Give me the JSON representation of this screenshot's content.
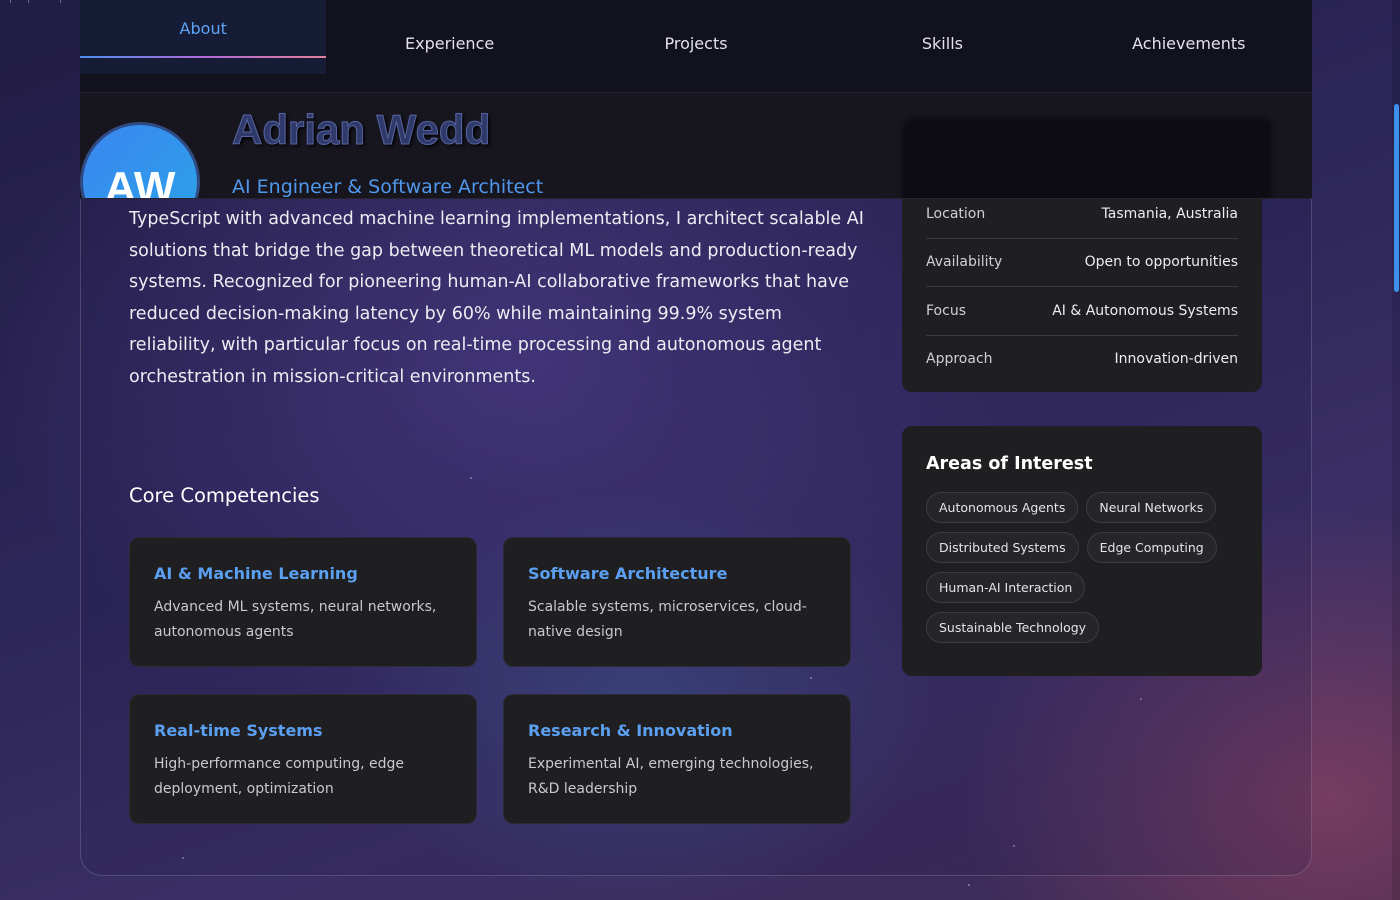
{
  "nav": {
    "tabs": [
      {
        "label": "About",
        "active": true
      },
      {
        "label": "Experience",
        "active": false
      },
      {
        "label": "Projects",
        "active": false
      },
      {
        "label": "Skills",
        "active": false
      },
      {
        "label": "Achievements",
        "active": false
      }
    ]
  },
  "profile": {
    "initials": "AW",
    "name": "Adrian Wedd",
    "role": "AI Engineer & Software Architect"
  },
  "bio": "TypeScript with advanced machine learning implementations, I architect scalable AI solutions that bridge the gap between theoretical ML models and production-ready systems. Recognized for pioneering human-AI collaborative frameworks that have reduced decision-making latency by 60% while maintaining 99.9% system reliability, with particular focus on real-time processing and autonomous agent orchestration in mission-critical environments.",
  "competencies": {
    "heading": "Core Competencies",
    "items": [
      {
        "title": "AI & Machine Learning",
        "desc": "Advanced ML systems, neural networks, autonomous agents"
      },
      {
        "title": "Software Architecture",
        "desc": "Scalable systems, microservices, cloud-native design"
      },
      {
        "title": "Real-time Systems",
        "desc": "High-performance computing, edge deployment, optimization"
      },
      {
        "title": "Research & Innovation",
        "desc": "Experimental AI, emerging technologies, R&D leadership"
      }
    ]
  },
  "info": {
    "rows": [
      {
        "key": "Location",
        "value": "Tasmania, Australia"
      },
      {
        "key": "Availability",
        "value": "Open to opportunities"
      },
      {
        "key": "Focus",
        "value": "AI & Autonomous Systems"
      },
      {
        "key": "Approach",
        "value": "Innovation-driven"
      }
    ]
  },
  "interests": {
    "heading": "Areas of Interest",
    "chips": [
      "Autonomous Agents",
      "Neural Networks",
      "Distributed Systems",
      "Edge Computing",
      "Human-AI Interaction",
      "Sustainable Technology"
    ]
  },
  "colors": {
    "accent": "#5b9ff0",
    "nav_bg": "#12111e",
    "card_bg": "#1f1f22"
  }
}
